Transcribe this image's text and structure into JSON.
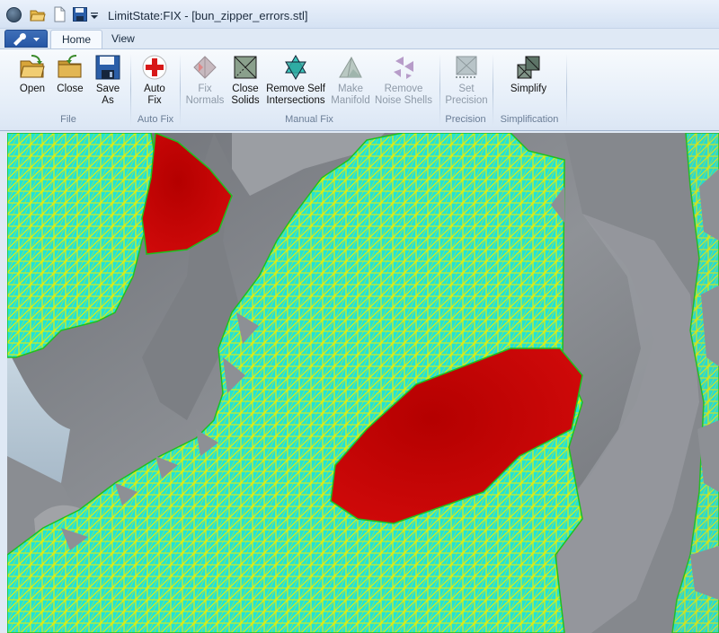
{
  "window": {
    "title": "LimitState:FIX - [bun_zipper_errors.stl]"
  },
  "quick_access": {
    "icons": [
      "open-folder-icon",
      "new-document-icon",
      "save-disk-icon",
      "dropdown-arrow-icon"
    ]
  },
  "tabs": [
    {
      "label": "Home",
      "active": true
    },
    {
      "label": "View",
      "active": false
    }
  ],
  "ribbon": {
    "groups": [
      {
        "label": "File"
      },
      {
        "label": "Auto Fix"
      },
      {
        "label": "Manual Fix"
      },
      {
        "label": "Precision"
      },
      {
        "label": "Simplification"
      }
    ],
    "buttons": {
      "open": {
        "line1": "Open",
        "line2": ""
      },
      "close": {
        "line1": "Close",
        "line2": ""
      },
      "save_as": {
        "line1": "Save",
        "line2": "As"
      },
      "auto_fix": {
        "line1": "Auto",
        "line2": "Fix"
      },
      "fix_normals": {
        "line1": "Fix",
        "line2": "Normals"
      },
      "close_solids": {
        "line1": "Close",
        "line2": "Solids"
      },
      "remove_self_intersections": {
        "line1": "Remove Self",
        "line2": "Intersections"
      },
      "make_manifold": {
        "line1": "Make",
        "line2": "Manifold"
      },
      "remove_noise_shells": {
        "line1": "Remove",
        "line2": "Noise Shells"
      },
      "set_precision": {
        "line1": "Set",
        "line2": "Precision"
      },
      "simplify": {
        "line1": "Simplify",
        "line2": ""
      }
    }
  },
  "colors": {
    "mesh_gray": "#8d8f93",
    "error_region": "#c00000",
    "highlight_faces": "#22e6d8",
    "wire": "#f4f400",
    "boundary": "#1fc01f"
  }
}
